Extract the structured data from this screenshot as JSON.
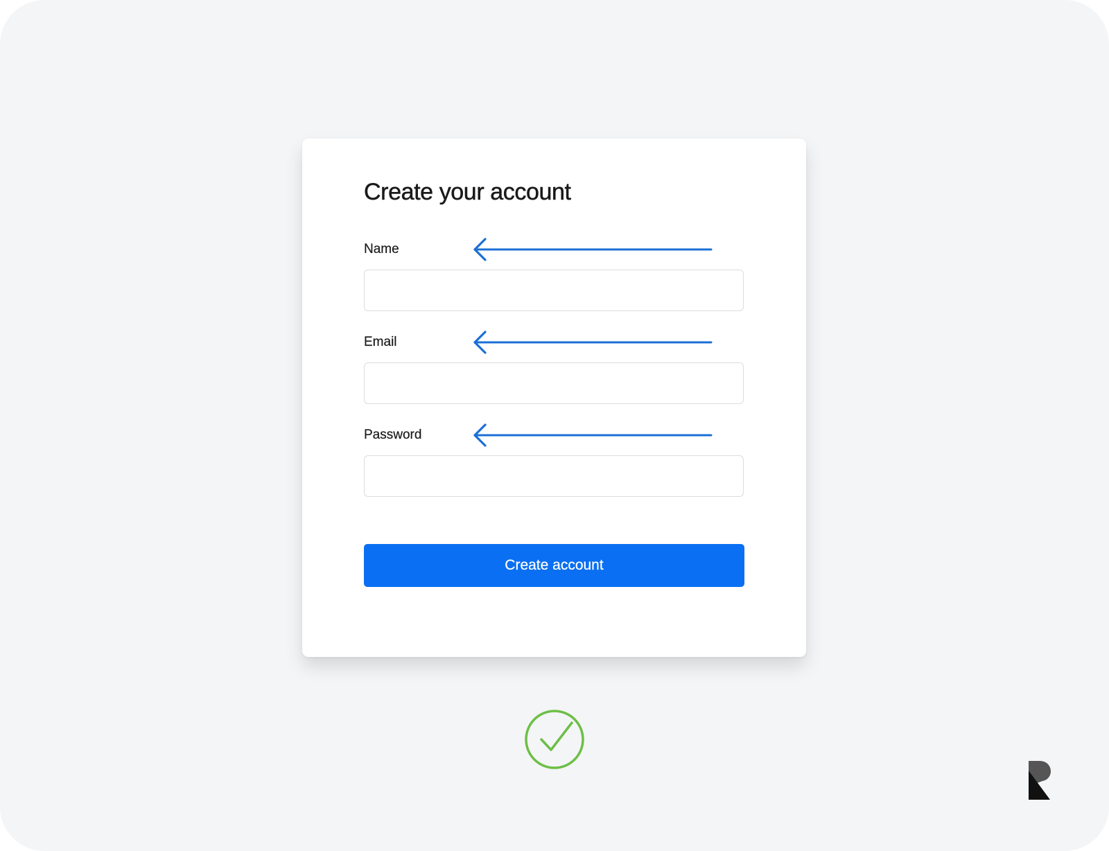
{
  "form": {
    "title": "Create your account",
    "fields": [
      {
        "label": "Name",
        "value": "",
        "placeholder": ""
      },
      {
        "label": "Email",
        "value": "",
        "placeholder": ""
      },
      {
        "label": "Password",
        "value": "",
        "placeholder": ""
      }
    ],
    "submit_label": "Create account"
  },
  "annotations": {
    "arrow_icon": "arrow-left-icon",
    "arrow_color": "#1a6fd6"
  },
  "status": {
    "icon": "check-circle-icon",
    "color": "#6cbf46"
  },
  "branding": {
    "icon": "logo-r-icon"
  },
  "colors": {
    "background": "#f4f5f7",
    "card": "#ffffff",
    "accent": "#0a6ff2"
  }
}
